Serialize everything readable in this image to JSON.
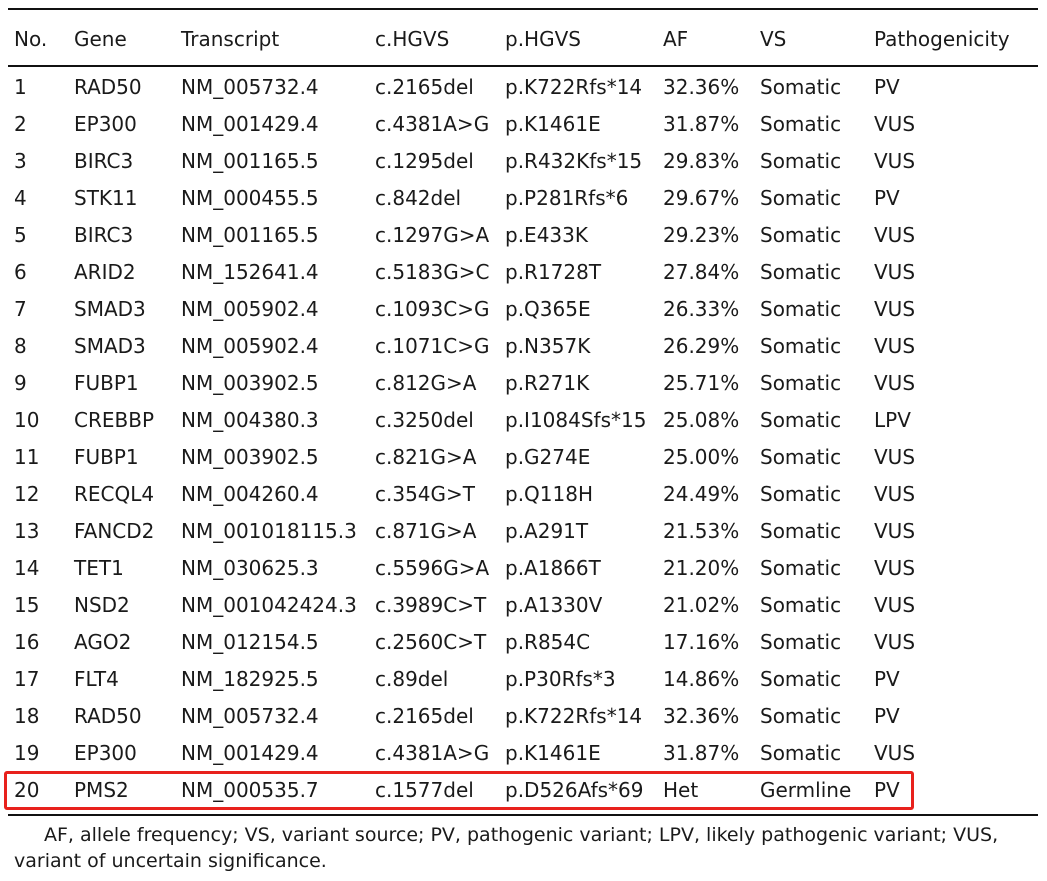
{
  "table": {
    "columns": [
      "No.",
      "Gene",
      "Transcript",
      "c.HGVS",
      "p.HGVS",
      "AF",
      "VS",
      "Pathogenicity"
    ],
    "rows": [
      [
        "1",
        "RAD50",
        "NM_005732.4",
        "c.2165del",
        "p.K722Rfs*14",
        "32.36%",
        "Somatic",
        "PV"
      ],
      [
        "2",
        "EP300",
        "NM_001429.4",
        "c.4381A>G",
        "p.K1461E",
        "31.87%",
        "Somatic",
        "VUS"
      ],
      [
        "3",
        "BIRC3",
        "NM_001165.5",
        "c.1295del",
        "p.R432Kfs*15",
        "29.83%",
        "Somatic",
        "VUS"
      ],
      [
        "4",
        "STK11",
        "NM_000455.5",
        "c.842del",
        "p.P281Rfs*6",
        "29.67%",
        "Somatic",
        "PV"
      ],
      [
        "5",
        "BIRC3",
        "NM_001165.5",
        "c.1297G>A",
        "p.E433K",
        "29.23%",
        "Somatic",
        "VUS"
      ],
      [
        "6",
        "ARID2",
        "NM_152641.4",
        "c.5183G>C",
        "p.R1728T",
        "27.84%",
        "Somatic",
        "VUS"
      ],
      [
        "7",
        "SMAD3",
        "NM_005902.4",
        "c.1093C>G",
        "p.Q365E",
        "26.33%",
        "Somatic",
        "VUS"
      ],
      [
        "8",
        "SMAD3",
        "NM_005902.4",
        "c.1071C>G",
        "p.N357K",
        "26.29%",
        "Somatic",
        "VUS"
      ],
      [
        "9",
        "FUBP1",
        "NM_003902.5",
        "c.812G>A",
        "p.R271K",
        "25.71%",
        "Somatic",
        "VUS"
      ],
      [
        "10",
        "CREBBP",
        "NM_004380.3",
        "c.3250del",
        "p.I1084Sfs*15",
        "25.08%",
        "Somatic",
        "LPV"
      ],
      [
        "11",
        "FUBP1",
        "NM_003902.5",
        "c.821G>A",
        "p.G274E",
        "25.00%",
        "Somatic",
        "VUS"
      ],
      [
        "12",
        "RECQL4",
        "NM_004260.4",
        "c.354G>T",
        "p.Q118H",
        "24.49%",
        "Somatic",
        "VUS"
      ],
      [
        "13",
        "FANCD2",
        "NM_001018115.3",
        "c.871G>A",
        "p.A291T",
        "21.53%",
        "Somatic",
        "VUS"
      ],
      [
        "14",
        "TET1",
        "NM_030625.3",
        "c.5596G>A",
        "p.A1866T",
        "21.20%",
        "Somatic",
        "VUS"
      ],
      [
        "15",
        "NSD2",
        "NM_001042424.3",
        "c.3989C>T",
        "p.A1330V",
        "21.02%",
        "Somatic",
        "VUS"
      ],
      [
        "16",
        "AGO2",
        "NM_012154.5",
        "c.2560C>T",
        "p.R854C",
        "17.16%",
        "Somatic",
        "VUS"
      ],
      [
        "17",
        "FLT4",
        "NM_182925.5",
        "c.89del",
        "p.P30Rfs*3",
        "14.86%",
        "Somatic",
        "PV"
      ],
      [
        "18",
        "RAD50",
        "NM_005732.4",
        "c.2165del",
        "p.K722Rfs*14",
        "32.36%",
        "Somatic",
        "PV"
      ],
      [
        "19",
        "EP300",
        "NM_001429.4",
        "c.4381A>G",
        "p.K1461E",
        "31.87%",
        "Somatic",
        "VUS"
      ],
      [
        "20",
        "PMS2",
        "NM_000535.7",
        "c.1577del",
        "p.D526Afs*69",
        "Het",
        "Germline",
        "PV"
      ]
    ],
    "highlighted_row": "20"
  },
  "footnote": "AF, allele frequency; VS, variant source; PV, pathogenic variant; LPV, likely pathogenic variant; VUS, variant of uncertain significance.",
  "colors": {
    "highlight_border": "#e8211c",
    "rules": "#111111",
    "text": "#1a1a1a"
  }
}
